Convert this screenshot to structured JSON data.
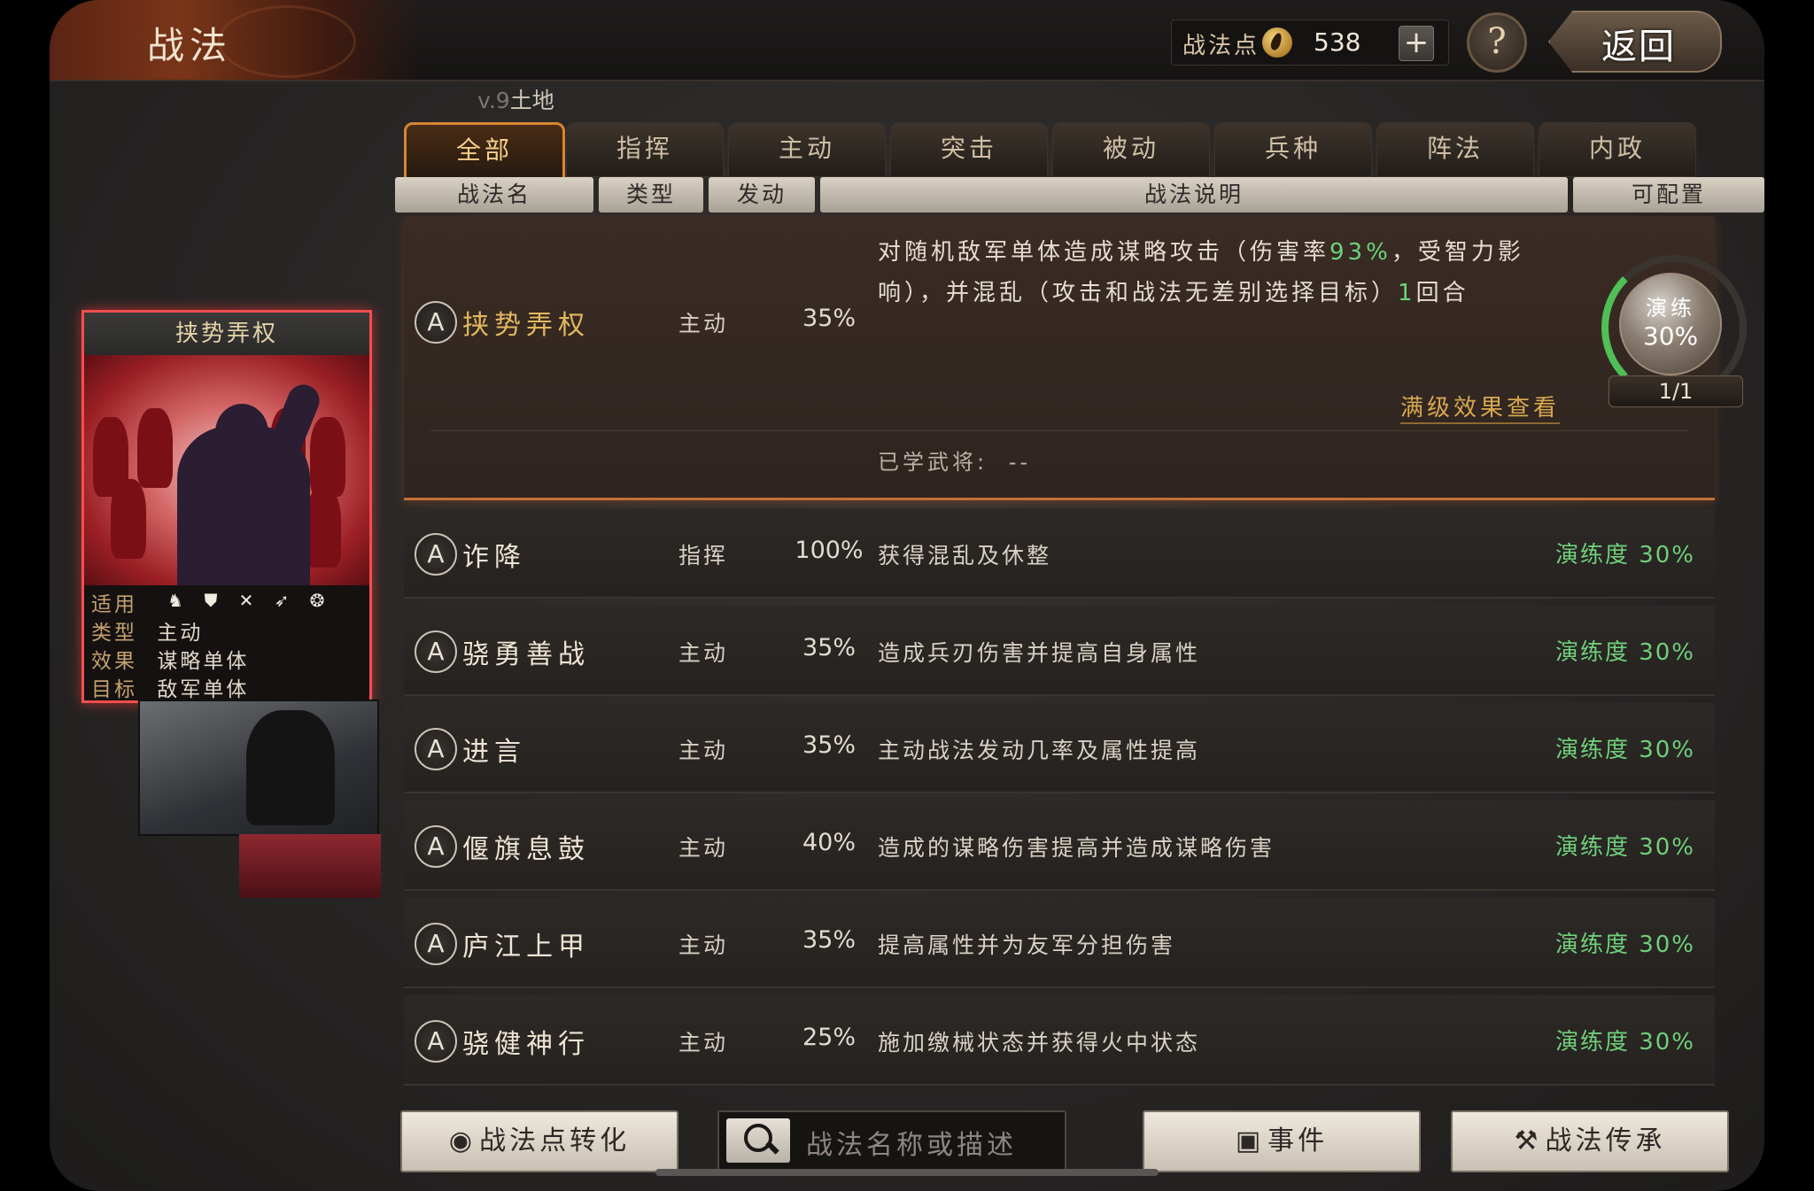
{
  "header": {
    "title": "战法",
    "points_label": "战法点",
    "points_value": "538",
    "plus": "+",
    "help": "?",
    "back": "返回"
  },
  "version": {
    "prefix": "v.9",
    "text": "土地"
  },
  "tabs": [
    {
      "label": "全部",
      "active": true
    },
    {
      "label": "指挥"
    },
    {
      "label": "主动"
    },
    {
      "label": "突击"
    },
    {
      "label": "被动"
    },
    {
      "label": "兵种"
    },
    {
      "label": "阵法"
    },
    {
      "label": "内政"
    }
  ],
  "columns": [
    "战法名",
    "类型",
    "发动",
    "战法说明",
    "可配置"
  ],
  "card": {
    "title": "挟势弄权",
    "applicable_label": "适用",
    "applicable_icons": [
      "cavalry-icon",
      "shield-icon",
      "bow-icon",
      "spear-icon",
      "wheel-icon"
    ],
    "type_label": "类型",
    "type_value": "主动",
    "effect_label": "效果",
    "effect_value": "谋略单体",
    "target_label": "目标",
    "target_value": "敌军单体"
  },
  "selected": {
    "grade": "A",
    "name": "挟势弄权",
    "type": "主动",
    "rate": "35%",
    "desc_1": "对随机敌军单体造成谋略攻击（伤害率",
    "desc_hl1": "93%",
    "desc_2": "，受智力影响），并混乱（攻击和战法无差别选择目标）",
    "desc_hl2": "1",
    "desc_3": "回合",
    "max_link": "满级效果查看",
    "learned_label": "已学武将:",
    "learned_value": "--",
    "train_label": "演练",
    "train_value": "30%",
    "count": "1/1"
  },
  "rows": [
    {
      "grade": "A",
      "name": "诈降",
      "type": "指挥",
      "rate": "100%",
      "desc": "获得混乱及休整",
      "train": "演练度 30%"
    },
    {
      "grade": "A",
      "name": "骁勇善战",
      "type": "主动",
      "rate": "35%",
      "desc": "造成兵刃伤害并提高自身属性",
      "train": "演练度 30%"
    },
    {
      "grade": "A",
      "name": "进言",
      "type": "主动",
      "rate": "35%",
      "desc": "主动战法发动几率及属性提高",
      "train": "演练度 30%"
    },
    {
      "grade": "A",
      "name": "偃旗息鼓",
      "type": "主动",
      "rate": "40%",
      "desc": "造成的谋略伤害提高并造成谋略伤害",
      "train": "演练度 30%"
    },
    {
      "grade": "A",
      "name": "庐江上甲",
      "type": "主动",
      "rate": "35%",
      "desc": "提高属性并为友军分担伤害",
      "train": "演练度 30%"
    },
    {
      "grade": "A",
      "name": "骁健神行",
      "type": "主动",
      "rate": "25%",
      "desc": "施加缴械状态并获得火中状态",
      "train": "演练度 30%"
    }
  ],
  "bottom": {
    "convert": "战法点转化",
    "search_placeholder": "战法名称或描述",
    "events": "事件",
    "inherit": "战法传承"
  },
  "colors": {
    "accent": "#d68630",
    "train_green": "#6fcf7a",
    "card_border": "#f24e4e",
    "gold_text": "#e3b95e"
  }
}
